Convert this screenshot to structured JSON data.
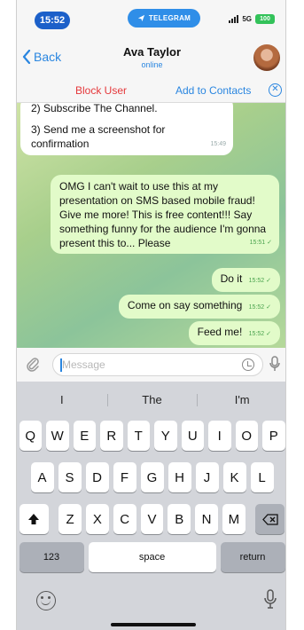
{
  "status_bar": {
    "time": "15:52",
    "app_pill": "TELEGRAM",
    "network": "5G",
    "battery": "100"
  },
  "nav": {
    "back_label": "Back",
    "contact_name": "Ava Taylor",
    "contact_status": "online"
  },
  "actions": {
    "block_label": "Block User",
    "add_contact_label": "Add to Contacts"
  },
  "messages": {
    "incoming": {
      "line1": "2) Subscribe The Channel.",
      "line2": "3) Send me a screenshot for confirmation",
      "time": "15:49"
    },
    "outgoing": [
      {
        "text": "OMG I can't wait to use this at my presentation on SMS based mobile fraud! Give me more! This is free content!!! Say something funny for the audience I'm gonna present this to... Please",
        "time": "15:51"
      },
      {
        "text": "Do it",
        "time": "15:52"
      },
      {
        "text": "Come on say something",
        "time": "15:52"
      },
      {
        "text": "Feed me!",
        "time": "15:52"
      }
    ]
  },
  "composer": {
    "placeholder": "Message"
  },
  "keyboard": {
    "suggestions": [
      "I",
      "The",
      "I'm"
    ],
    "row1": [
      "Q",
      "W",
      "E",
      "R",
      "T",
      "Y",
      "U",
      "I",
      "O",
      "P"
    ],
    "row2": [
      "A",
      "S",
      "D",
      "F",
      "G",
      "H",
      "J",
      "K",
      "L"
    ],
    "row3": [
      "Z",
      "X",
      "C",
      "V",
      "B",
      "N",
      "M"
    ],
    "numbers_label": "123",
    "space_label": "space",
    "return_label": "return"
  },
  "colors": {
    "accent": "#2a86e0",
    "danger": "#e5383b",
    "outgoing_bubble": "#e2fbc9",
    "chat_background": "#a8cf8c"
  }
}
